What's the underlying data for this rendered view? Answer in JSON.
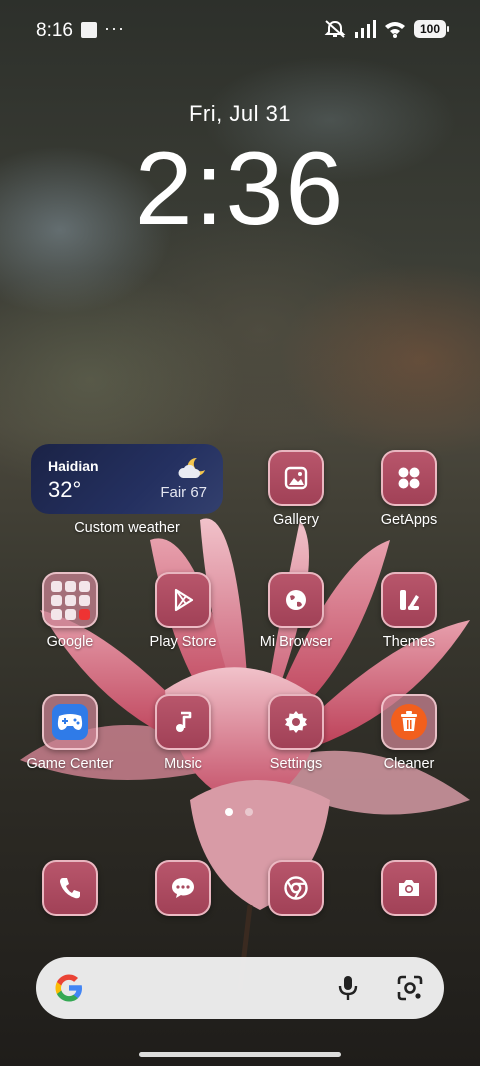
{
  "status_bar": {
    "time": "8:16",
    "overflow": "···",
    "battery": "100",
    "icons": [
      "notification-square-icon",
      "mute-icon",
      "signal-icon",
      "wifi-icon",
      "battery-icon"
    ]
  },
  "lock": {
    "date": "Fri, Jul 31",
    "time": "2:36"
  },
  "weather": {
    "city": "Haidian",
    "temperature": "32°",
    "condition": "Fair 67",
    "icon": "partly-cloudy-night-icon",
    "label": "Custom weather"
  },
  "apps": {
    "gallery": {
      "label": "Gallery",
      "icon": "gallery-icon"
    },
    "getapps": {
      "label": "GetApps",
      "icon": "getapps-icon"
    },
    "google": {
      "label": "Google",
      "icon": "folder-icon"
    },
    "play_store": {
      "label": "Play Store",
      "icon": "play-store-icon"
    },
    "mi_browser": {
      "label": "Mi Browser",
      "icon": "globe-icon"
    },
    "themes": {
      "label": "Themes",
      "icon": "themes-icon"
    },
    "game_center": {
      "label": "Game Center",
      "icon": "gamepad-icon"
    },
    "music": {
      "label": "Music",
      "icon": "music-note-icon"
    },
    "settings": {
      "label": "Settings",
      "icon": "gear-icon"
    },
    "cleaner": {
      "label": "Cleaner",
      "icon": "trash-icon"
    }
  },
  "dock": [
    "phone-icon",
    "messages-icon",
    "chrome-icon",
    "camera-icon"
  ],
  "pager": {
    "pages": 2,
    "active": 1
  },
  "search": {
    "icons": [
      "google-g-icon",
      "microphone-icon",
      "lens-icon"
    ]
  },
  "colors": {
    "tile": "#a84a5f",
    "weather_bg": "#1f2a52",
    "search_bg": "#f0f0f0",
    "cleaner_accent": "#f25f1d",
    "game_accent": "#2f7be8"
  }
}
